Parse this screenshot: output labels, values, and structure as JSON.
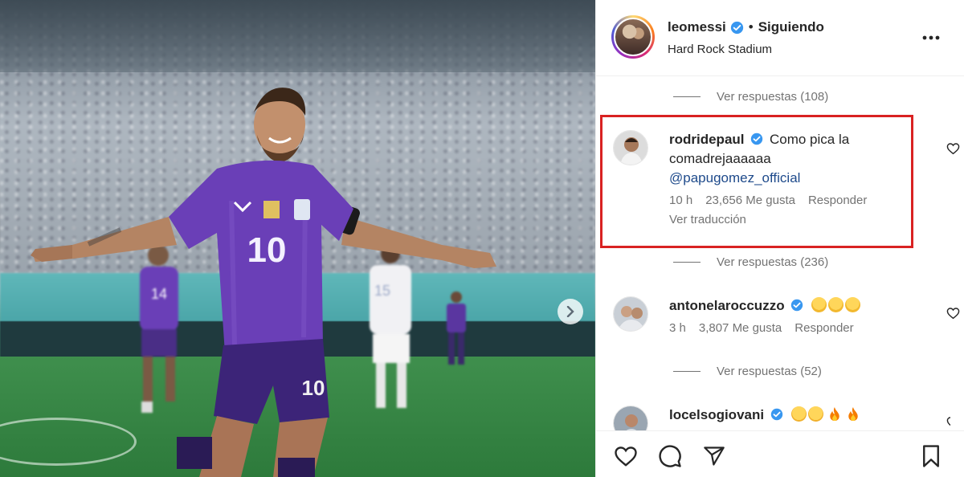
{
  "post": {
    "username": "leomessi",
    "separator": "•",
    "follow_status": "Siguiendo",
    "location": "Hard Rock Stadium",
    "jersey_number": "10",
    "jersey_number_bg_player": "14",
    "jersey_number_opponent": "15"
  },
  "replies_before_highlight": {
    "label": "Ver respuestas (108)"
  },
  "highlighted_comment": {
    "username": "rodridepaul",
    "text_line1": "Como pica la",
    "text_line2": "comadrejaaaaaa",
    "mention": "@papugomez_official",
    "time": "10 h",
    "likes": "23,656 Me gusta",
    "reply": "Responder",
    "translate": "Ver traducción"
  },
  "replies_after_highlight": {
    "label": "Ver respuestas (236)"
  },
  "comment2": {
    "username": "antonelaroccuzzo",
    "time": "3 h",
    "likes": "3,807 Me gusta",
    "reply": "Responder",
    "emojis": [
      "face-screaming-in-fear",
      "face-screaming-in-fear",
      "face-screaming-in-fear"
    ]
  },
  "replies_comment2": {
    "label": "Ver respuestas (52)"
  },
  "comment3": {
    "username": "locelsogiovani",
    "emojis": [
      "smiling-face-with-heart-eyes",
      "smiling-face-with-heart-eyes",
      "fire",
      "fire"
    ]
  },
  "colors": {
    "highlight_border": "#d92222",
    "verified_blue": "#3897f0",
    "mention": "#1e4a8b",
    "jersey_purple": "#6a3fb7"
  },
  "icons": {
    "more": "more-horizontal-icon",
    "like": "heart-outline-icon",
    "comment": "comment-bubble-icon",
    "share": "paper-plane-icon",
    "save": "bookmark-icon",
    "next": "chevron-right-icon"
  }
}
